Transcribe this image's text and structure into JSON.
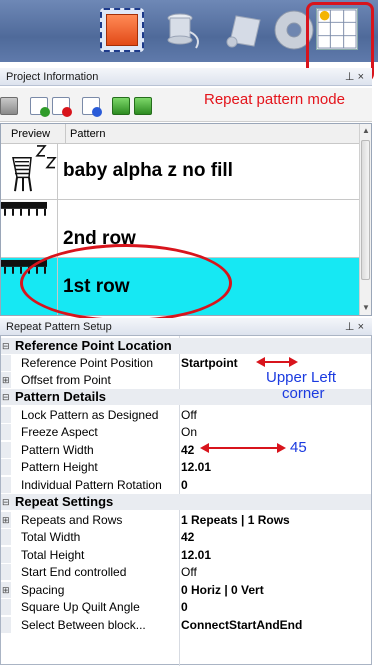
{
  "toolbar": {
    "icons": [
      "frame-select-icon",
      "thread-spool-icon",
      "scroll-icon",
      "disc-icon",
      "repeat-pattern-icon"
    ]
  },
  "project_info": {
    "title": "Project Information",
    "pin": "⊥",
    "close": "×"
  },
  "annotations": {
    "repeat_mode": "Repeat pattern mode",
    "upper_left": "Upper Left",
    "corner": "corner",
    "width_new": "45"
  },
  "pattern_list": {
    "col_preview": "Preview",
    "col_pattern": "Pattern",
    "rows": [
      {
        "name": "baby alpha z no fill",
        "selected": false
      },
      {
        "name": "2nd row",
        "selected": false
      },
      {
        "name": "1st row",
        "selected": true
      }
    ]
  },
  "repeat_setup": {
    "title": "Repeat Pattern Setup",
    "pin": "⊥",
    "close": "×",
    "sections": {
      "reference": "Reference Point Location",
      "details": "Pattern Details",
      "repeat": "Repeat Settings"
    },
    "props": {
      "ref_pos_label": "Reference Point Position",
      "ref_pos_value": "Startpoint",
      "offset_label": "Offset from Point",
      "lock_label": "Lock Pattern as Designed",
      "lock_value": "Off",
      "freeze_label": "Freeze Aspect",
      "freeze_value": "On",
      "width_label": "Pattern Width",
      "width_value": "42",
      "height_label": "Pattern Height",
      "height_value": "12.01",
      "rotation_label": "Individual Pattern Rotation",
      "rotation_value": "0",
      "repeats_label": "Repeats and Rows",
      "repeats_value": "1 Repeats | 1 Rows",
      "total_width_label": "Total Width",
      "total_width_value": "42",
      "total_height_label": "Total Height",
      "total_height_value": "12.01",
      "start_end_label": "Start End controlled",
      "start_end_value": "Off",
      "spacing_label": "Spacing",
      "spacing_value": "0 Horiz | 0 Vert",
      "square_label": "Square Up Quilt Angle",
      "square_value": "0",
      "select_label": "Select Between block...",
      "select_value": "ConnectStartAndEnd"
    }
  },
  "colors": {
    "selected_row": "#16e8f3",
    "annotation_red": "#d8141c",
    "annotation_blue": "#1a3ae0"
  }
}
